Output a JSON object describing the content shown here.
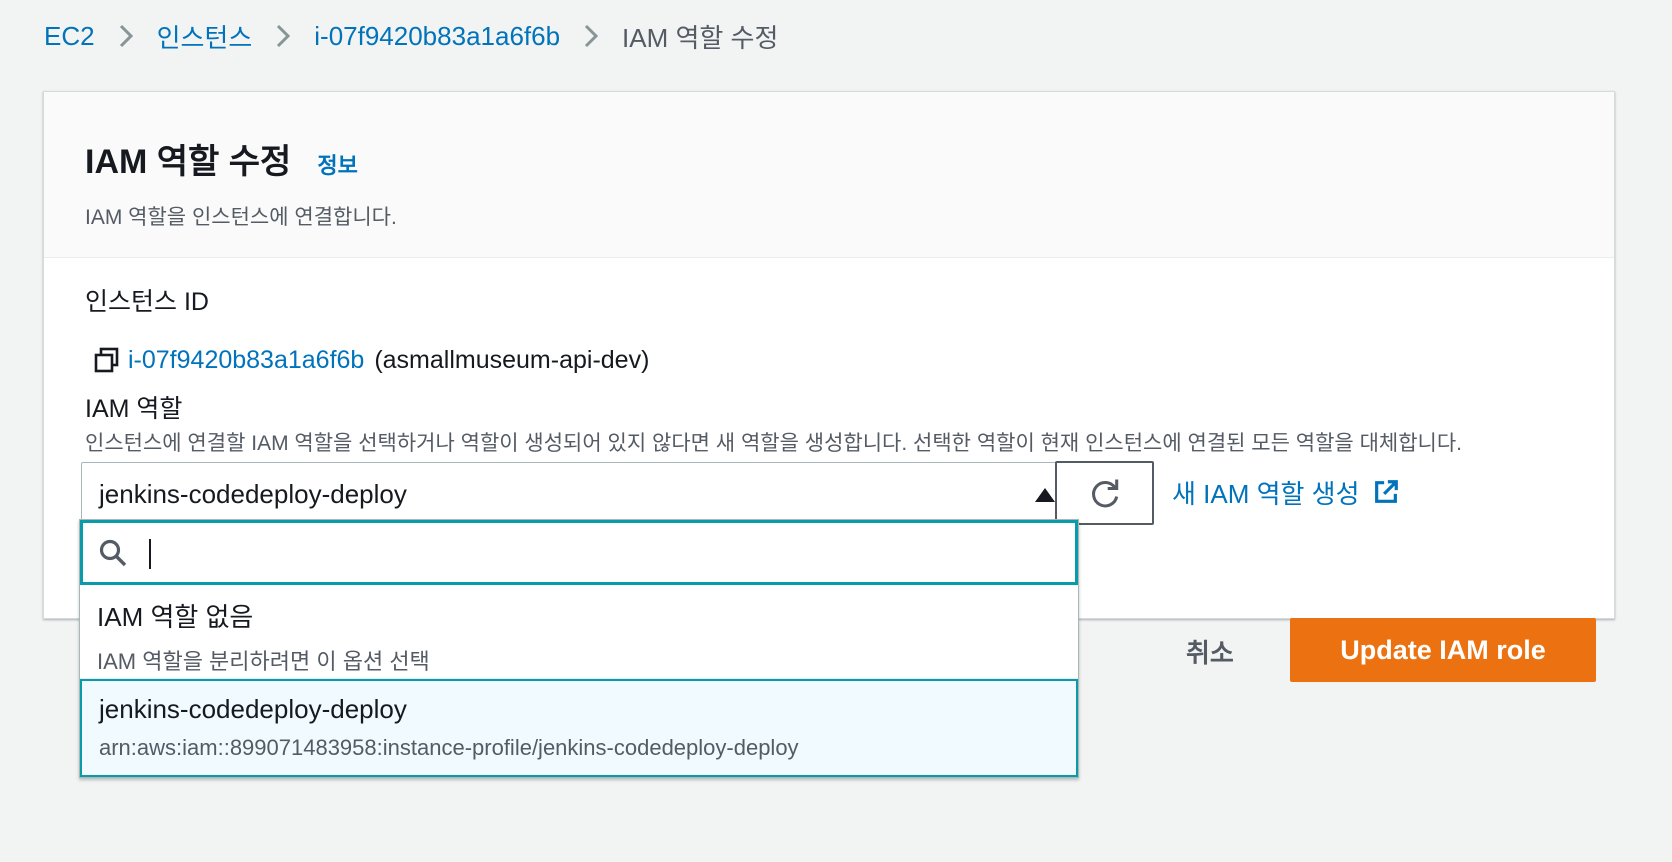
{
  "breadcrumb": {
    "items": [
      "EC2",
      "인스턴스",
      "i-07f9420b83a1a6f6b"
    ],
    "current": "IAM 역할 수정"
  },
  "header": {
    "title": "IAM 역할 수정",
    "info_link": "정보",
    "description": "IAM 역할을 인스턴스에 연결합니다."
  },
  "instance": {
    "label": "인스턴스 ID",
    "id": "i-07f9420b83a1a6f6b",
    "name": "(asmallmuseum-api-dev)"
  },
  "iam_role": {
    "label": "IAM 역할",
    "description": "인스턴스에 연결할 IAM 역할을 선택하거나 역할이 생성되어 있지 않다면 새 역할을 생성합니다. 선택한 역할이 현재 인스턴스에 연결된 모든 역할을 대체합니다.",
    "selected_value": "jenkins-codedeploy-deploy",
    "create_link": "새 IAM 역할 생성",
    "search_value": "",
    "options": [
      {
        "label": "IAM 역할 없음",
        "description": "IAM 역할을 분리하려면 이 옵션 선택"
      },
      {
        "label": "jenkins-codedeploy-deploy",
        "description": "arn:aws:iam::899071483958:instance-profile/jenkins-codedeploy-deploy"
      }
    ]
  },
  "actions": {
    "cancel": "취소",
    "submit": "Update IAM role"
  },
  "colors": {
    "link": "#0073bb",
    "primary": "#ec7211",
    "focus": "#0a9ba8",
    "selected_bg": "#f1faff"
  }
}
